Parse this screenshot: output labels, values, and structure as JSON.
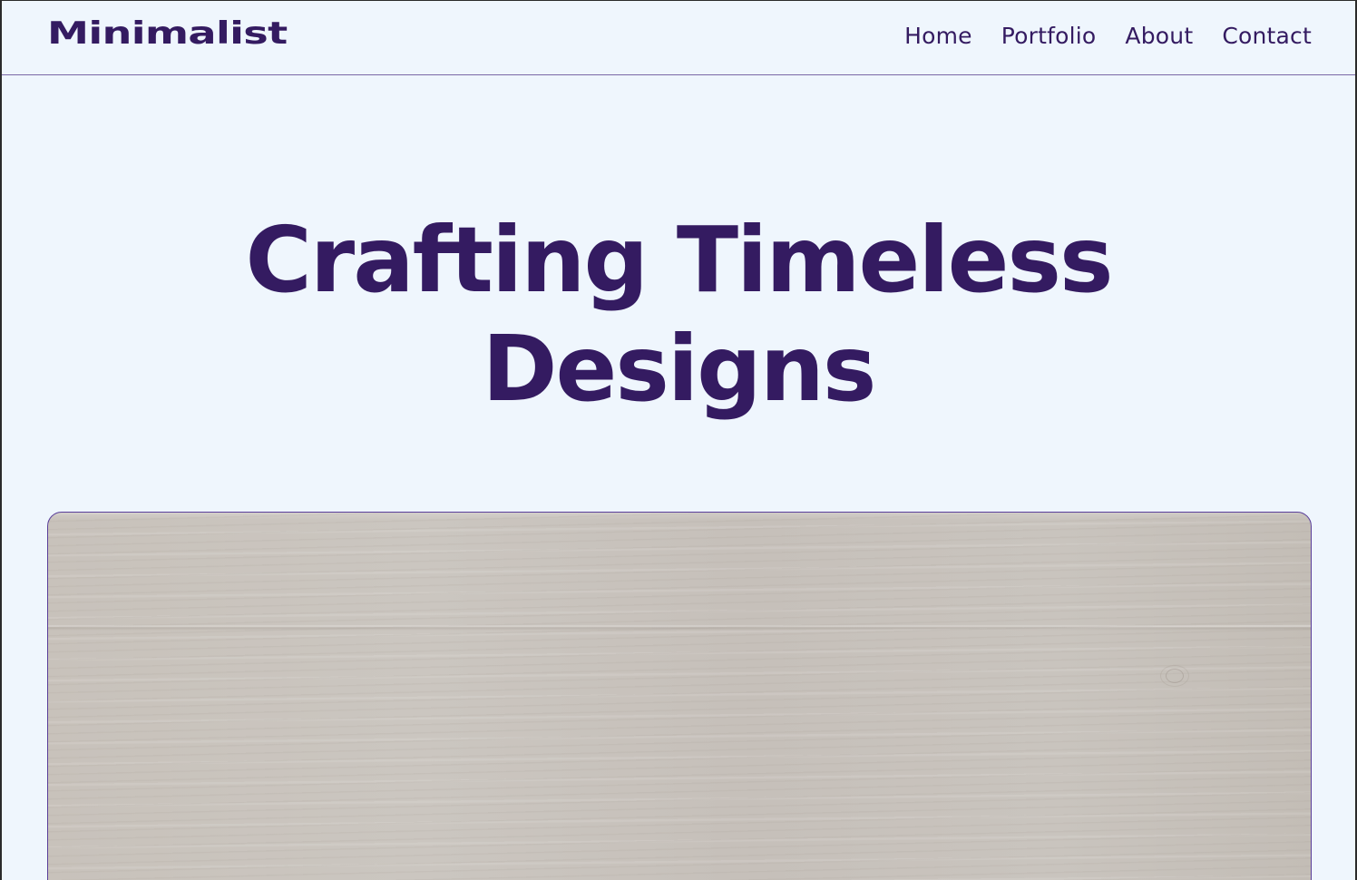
{
  "brand": {
    "logo_text": "Minimalist"
  },
  "nav": {
    "items": [
      {
        "label": "Home"
      },
      {
        "label": "Portfolio"
      },
      {
        "label": "About"
      },
      {
        "label": "Contact"
      }
    ]
  },
  "hero": {
    "title_line1": "Crafting Timeless",
    "title_line2": "Designs",
    "image_icon": "wood-texture-image"
  },
  "colors": {
    "background": "#eff6fd",
    "primary": "#341b61",
    "divider": "#7a68a6"
  }
}
